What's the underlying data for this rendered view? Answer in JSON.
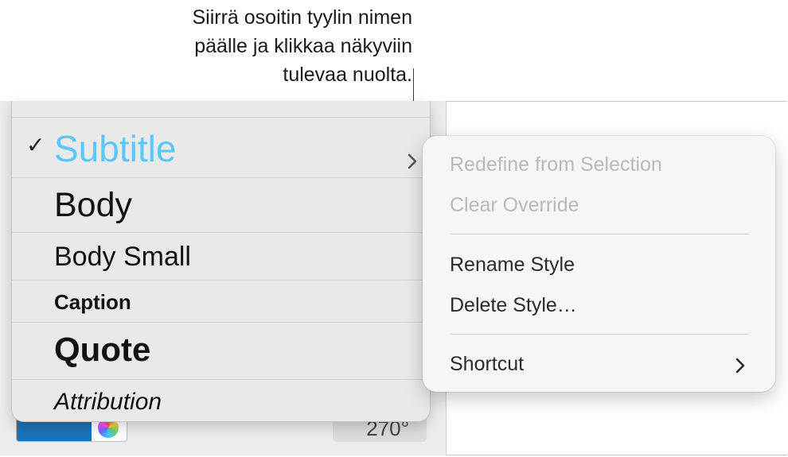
{
  "callout": {
    "line1": "Siirrä osoitin tyylin nimen",
    "line2": "päälle ja klikkaa näkyviin",
    "line3": "tulevaa nuolta."
  },
  "style_list": {
    "items": [
      {
        "label": "Subtitle",
        "selected": true,
        "color": "#5ac8fa"
      },
      {
        "label": "Body"
      },
      {
        "label": "Body Small"
      },
      {
        "label": "Caption"
      },
      {
        "label": "Quote"
      },
      {
        "label": "Attribution"
      }
    ],
    "checkmark": "✓"
  },
  "context_menu": {
    "redefine": "Redefine from Selection",
    "clear_override": "Clear Override",
    "rename": "Rename Style",
    "delete": "Delete Style…",
    "shortcut": "Shortcut"
  },
  "inspector": {
    "swatch_color": "#1a73b8",
    "angle_value": "270°"
  }
}
